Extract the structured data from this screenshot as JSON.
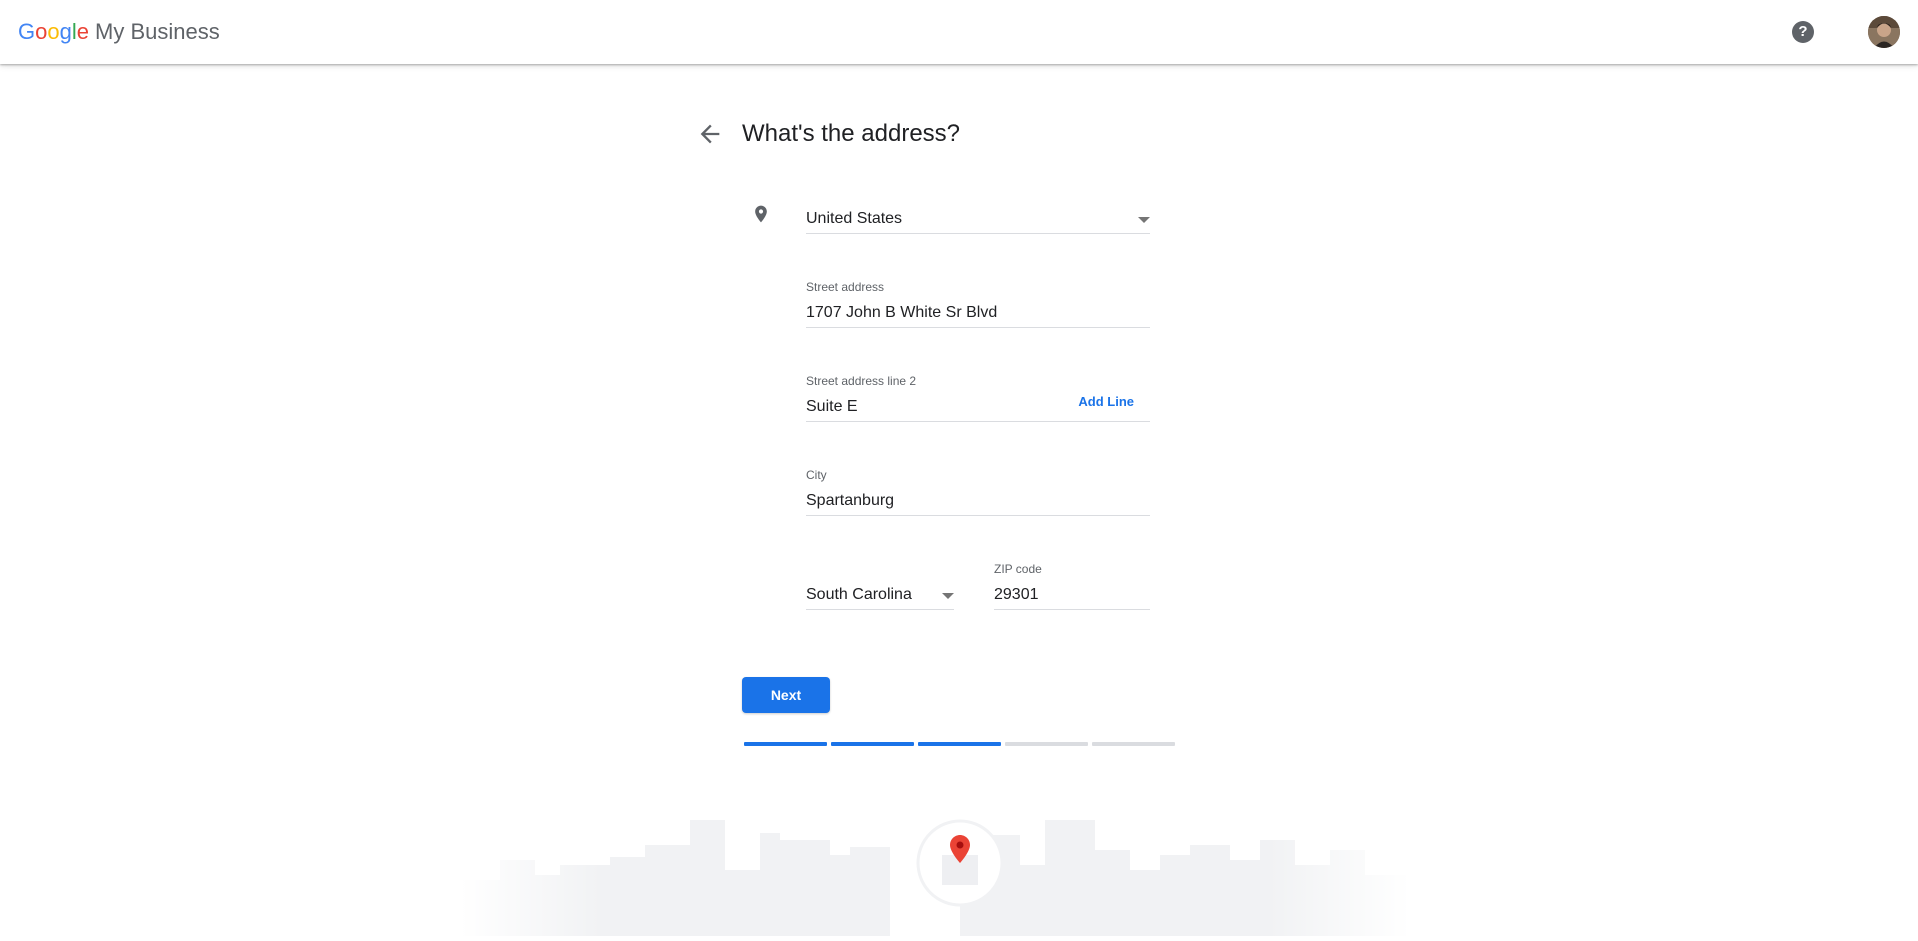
{
  "header": {
    "brand_google": [
      "G",
      "o",
      "o",
      "g",
      "l",
      "e"
    ],
    "brand_product": "My Business",
    "help_label": "?"
  },
  "page": {
    "title": "What's the address?"
  },
  "form": {
    "country": {
      "value": "United States"
    },
    "street": {
      "label": "Street address",
      "value": "1707 John B White Sr Blvd"
    },
    "street2": {
      "label": "Street address line 2",
      "value": "Suite E",
      "add_line": "Add Line"
    },
    "city": {
      "label": "City",
      "value": "Spartanburg"
    },
    "state": {
      "value": "South Carolina"
    },
    "zip": {
      "label": "ZIP code",
      "value": "29301"
    }
  },
  "actions": {
    "next_label": "Next"
  },
  "progress": {
    "total_steps": 5,
    "completed_steps": 3
  },
  "colors": {
    "accent": "#1a73e8",
    "progress_done": "#1a73e8",
    "progress_todo": "#dadce0",
    "pin": "#ea4335"
  },
  "icons": {
    "back": "arrow-back-icon",
    "location": "location-pin-icon",
    "help": "help-icon",
    "dropdown": "chevron-down-icon",
    "illustration": "map-pin-icon"
  }
}
